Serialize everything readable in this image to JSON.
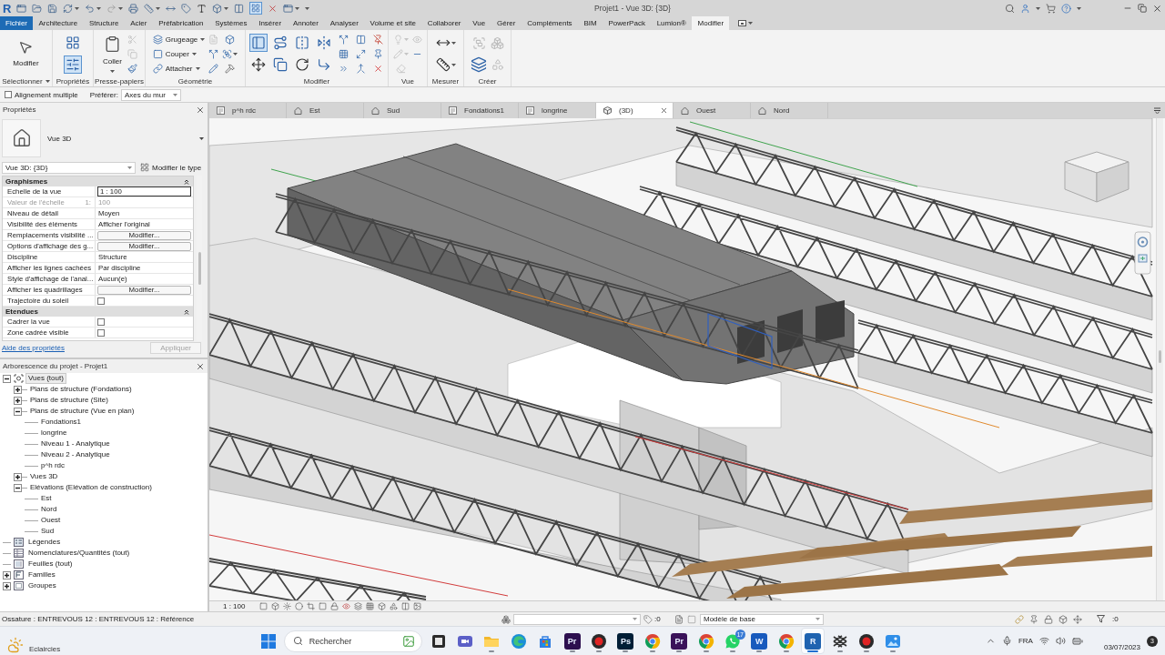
{
  "title_bar": {
    "logo": "R",
    "title": "Projet1 - Vue 3D: {3D}",
    "thin_lines": {
      "on": true
    }
  },
  "ribbon_tabs": [
    {
      "label": "Fichier",
      "kind": "file",
      "selected": false
    },
    {
      "label": "Architecture",
      "kind": "tab",
      "selected": false
    },
    {
      "label": "Structure",
      "kind": "tab",
      "selected": false
    },
    {
      "label": "Acier",
      "kind": "tab",
      "selected": false
    },
    {
      "label": "Préfabrication",
      "kind": "tab",
      "selected": false
    },
    {
      "label": "Systèmes",
      "kind": "tab",
      "selected": false
    },
    {
      "label": "Insérer",
      "kind": "tab",
      "selected": false
    },
    {
      "label": "Annoter",
      "kind": "tab",
      "selected": false
    },
    {
      "label": "Analyser",
      "kind": "tab",
      "selected": false
    },
    {
      "label": "Volume et site",
      "kind": "tab",
      "selected": false
    },
    {
      "label": "Collaborer",
      "kind": "tab",
      "selected": false
    },
    {
      "label": "Vue",
      "kind": "tab",
      "selected": false
    },
    {
      "label": "Gérer",
      "kind": "tab",
      "selected": false
    },
    {
      "label": "Compléments",
      "kind": "tab",
      "selected": false
    },
    {
      "label": "BIM",
      "kind": "tab",
      "selected": false
    },
    {
      "label": "PowerPack",
      "kind": "tab",
      "selected": false
    },
    {
      "label": "Lumion®",
      "kind": "tab",
      "selected": false
    },
    {
      "label": "Modifier",
      "kind": "tab",
      "selected": true
    }
  ],
  "ribbon_panels": [
    {
      "label": "Sélectionner",
      "dropdown": true,
      "tools": [
        {
          "kind": "large",
          "label": "Modifier",
          "disabled": false
        }
      ]
    },
    {
      "label": "Propriétés",
      "dropdown": false,
      "tools": [
        {
          "kind": "icon",
          "disabled": false,
          "on": false
        },
        {
          "kind": "icon",
          "disabled": false,
          "on": true
        }
      ]
    },
    {
      "label": "Presse-papiers",
      "dropdown": false,
      "tools": [
        {
          "kind": "large",
          "label": "Coller",
          "disabled": false
        },
        {
          "kind": "icon",
          "disabled": true
        },
        {
          "kind": "icon",
          "disabled": true
        },
        {
          "kind": "icon",
          "disabled": false
        }
      ]
    },
    {
      "label": "Géométrie",
      "dropdown": false,
      "tools": [
        {
          "kind": "small",
          "label": "Grugeage",
          "disabled": false
        },
        {
          "kind": "small",
          "label": "Couper",
          "disabled": false
        },
        {
          "kind": "small",
          "label": "Attacher",
          "disabled": false
        },
        {
          "kind": "icon",
          "disabled": true
        },
        {
          "kind": "icon",
          "disabled": false
        },
        {
          "kind": "icon",
          "disabled": false
        },
        {
          "kind": "icon",
          "disabled": false
        },
        {
          "kind": "icon",
          "disabled": false
        },
        {
          "kind": "icon",
          "disabled": false
        }
      ]
    },
    {
      "label": "Modifier",
      "dropdown": false,
      "tools": [
        {
          "kind": "icon",
          "disabled": false,
          "on": true
        },
        {
          "kind": "icon",
          "disabled": false,
          "on": false
        },
        {
          "kind": "icon",
          "disabled": false,
          "on": false
        },
        {
          "kind": "icon",
          "disabled": false,
          "on": false
        },
        {
          "kind": "icon",
          "disabled": false,
          "on": false
        },
        {
          "kind": "icon",
          "disabled": false,
          "on": false
        },
        {
          "kind": "icon",
          "disabled": false,
          "on": false
        },
        {
          "kind": "icon",
          "disabled": false,
          "on": false
        },
        {
          "kind": "icon",
          "disabled": false,
          "on": false
        },
        {
          "kind": "icon",
          "disabled": false,
          "on": false
        },
        {
          "kind": "icon",
          "disabled": false,
          "on": false
        },
        {
          "kind": "icon",
          "disabled": false,
          "on": false
        },
        {
          "kind": "icon",
          "disabled": false,
          "on": false
        },
        {
          "kind": "icon",
          "disabled": false,
          "on": false
        },
        {
          "kind": "icon",
          "disabled": false,
          "on": false
        },
        {
          "kind": "icon",
          "disabled": false,
          "on": false
        },
        {
          "kind": "icon",
          "disabled": false,
          "on": false
        }
      ]
    },
    {
      "label": "Vue",
      "dropdown": false,
      "tools": [
        {
          "kind": "icon",
          "disabled": true
        },
        {
          "kind": "icon",
          "disabled": true
        },
        {
          "kind": "icon",
          "disabled": true
        },
        {
          "kind": "icon",
          "disabled": true
        },
        {
          "kind": "icon",
          "disabled": false
        }
      ]
    },
    {
      "label": "Mesurer",
      "dropdown": false,
      "tools": [
        {
          "kind": "icon",
          "disabled": false
        },
        {
          "kind": "icon",
          "disabled": false
        }
      ]
    },
    {
      "label": "Créer",
      "dropdown": false,
      "tools": [
        {
          "kind": "icon",
          "disabled": true
        },
        {
          "kind": "icon",
          "disabled": false
        },
        {
          "kind": "icon",
          "disabled": true
        },
        {
          "kind": "icon",
          "disabled": true
        }
      ]
    }
  ],
  "options_bar": {
    "multiple_alignment": {
      "label": "Alignement multiple",
      "checked": false
    },
    "prefer": {
      "label": "Préférer:",
      "value": "Axes du mur"
    }
  },
  "properties": {
    "title": "Propriétés",
    "type_name": "Vue 3D",
    "instance": "Vue 3D: {3D}",
    "edit_type": "Modifier le type",
    "groups": [
      {
        "label": "Graphismes",
        "expanded": true,
        "rows": [
          {
            "label": "Echelle de la vue",
            "kind": "input",
            "value": "1 : 100",
            "disabled": false
          },
          {
            "label": "Valeur de l'échelle",
            "label_suffix": "1:",
            "kind": "text",
            "value": "100",
            "disabled": true
          },
          {
            "label": "Niveau de détail",
            "kind": "text",
            "value": "Moyen",
            "disabled": false
          },
          {
            "label": "Visibilité des éléments",
            "kind": "text",
            "value": "Afficher l'original",
            "disabled": false
          },
          {
            "label": "Remplacements visibilité ...",
            "kind": "button",
            "value": "Modifier...",
            "disabled": false
          },
          {
            "label": "Options d'affichage des g...",
            "kind": "button",
            "value": "Modifier...",
            "disabled": false
          },
          {
            "label": "Discipline",
            "kind": "text",
            "value": "Structure",
            "disabled": false
          },
          {
            "label": "Afficher les lignes cachées",
            "kind": "text",
            "value": "Par discipline",
            "disabled": false
          },
          {
            "label": "Style d'affichage de l'anal...",
            "kind": "text",
            "value": "Aucun(e)",
            "disabled": false
          },
          {
            "label": "Afficher les quadrillages",
            "kind": "button",
            "value": "Modifier...",
            "disabled": false
          },
          {
            "label": "Trajectoire du soleil",
            "kind": "checkbox",
            "checked": false,
            "disabled": false
          }
        ]
      },
      {
        "label": "Etendues",
        "expanded": true,
        "rows": [
          {
            "label": "Cadrer la vue",
            "kind": "checkbox",
            "checked": false,
            "disabled": false
          },
          {
            "label": "Zone cadrée visible",
            "kind": "checkbox",
            "checked": false,
            "disabled": false
          }
        ]
      }
    ],
    "help_link": "Aide des propriétés",
    "apply": {
      "label": "Appliquer",
      "disabled": true
    }
  },
  "browser": {
    "title": "Arborescence du projet - Projet1",
    "tree": [
      {
        "label": "Vues (tout)",
        "kind": "views",
        "expanded": true,
        "selected": true,
        "children": [
          {
            "label": "Plans de structure (Fondations)",
            "expanded": false,
            "selected": false
          },
          {
            "label": "Plans de structure (Site)",
            "expanded": false,
            "selected": false
          },
          {
            "label": "Plans de structure (Vue en plan)",
            "expanded": true,
            "selected": false,
            "children": [
              {
                "label": "Fondations1",
                "selected": false
              },
              {
                "label": "longrine",
                "selected": false
              },
              {
                "label": "Niveau 1 - Analytique",
                "selected": false
              },
              {
                "label": "Niveau 2 - Analytique",
                "selected": false
              },
              {
                "label": "p^h rdc",
                "selected": false
              }
            ]
          },
          {
            "label": "Vues 3D",
            "expanded": false,
            "selected": false
          },
          {
            "label": "Elévations (Elévation de construction)",
            "expanded": true,
            "selected": false,
            "children": [
              {
                "label": "Est",
                "selected": false
              },
              {
                "label": "Nord",
                "selected": false
              },
              {
                "label": "Ouest",
                "selected": false
              },
              {
                "label": "Sud",
                "selected": false
              }
            ]
          }
        ]
      },
      {
        "label": "Légendes",
        "kind": "legends",
        "selected": false
      },
      {
        "label": "Nomenclatures/Quantités (tout)",
        "kind": "schedules",
        "selected": false
      },
      {
        "label": "Feuilles (tout)",
        "kind": "sheets",
        "selected": false
      },
      {
        "label": "Familles",
        "kind": "families",
        "expanded": false,
        "selected": false
      },
      {
        "label": "Groupes",
        "kind": "groups",
        "expanded": false,
        "selected": false
      }
    ]
  },
  "view_tabs": [
    {
      "label": "p^h rdc",
      "kind": "plan",
      "selected": false
    },
    {
      "label": "Est",
      "kind": "elevation",
      "selected": false
    },
    {
      "label": "Sud",
      "kind": "elevation",
      "selected": false
    },
    {
      "label": "Fondations1",
      "kind": "plan",
      "selected": false
    },
    {
      "label": "longrine",
      "kind": "plan",
      "selected": false
    },
    {
      "label": "(3D)",
      "kind": "perspective",
      "selected": true
    },
    {
      "label": "Ouest",
      "kind": "elevation",
      "selected": false
    },
    {
      "label": "Nord",
      "kind": "elevation",
      "selected": false
    }
  ],
  "view_control_bar": {
    "scale": "1 : 100"
  },
  "status_bar": {
    "message": "Ossature : ENTREVOUS 12 : ENTREVOUS 12 : Référence",
    "counter": ":0",
    "model": "Modèle de base",
    "filter_counter": ":0"
  },
  "taskbar": {
    "weather": "Eclaircies",
    "search": {
      "placeholder": "Rechercher"
    },
    "apps": [
      {
        "kind": "square",
        "running": false,
        "active": false
      },
      {
        "kind": "chat",
        "running": false,
        "active": false
      },
      {
        "kind": "folder",
        "running": true,
        "active": false
      },
      {
        "kind": "edge",
        "running": false,
        "active": false
      },
      {
        "kind": "store",
        "running": false,
        "active": false
      },
      {
        "kind": "tile",
        "label": "Pr",
        "color": "#2d0f4f",
        "running": true,
        "active": false
      },
      {
        "kind": "record",
        "running": true,
        "active": false
      },
      {
        "kind": "tile",
        "label": "Ps",
        "color": "#001e36",
        "running": true,
        "active": false
      },
      {
        "kind": "chrome",
        "running": true,
        "active": false
      },
      {
        "kind": "tile",
        "label": "Pr",
        "color": "#3a1259",
        "running": true,
        "active": false
      },
      {
        "kind": "chrome",
        "running": true,
        "active": false
      },
      {
        "kind": "whatsapp",
        "badge": "17",
        "running": true,
        "active": false
      },
      {
        "kind": "tile",
        "label": "W",
        "color": "#185abd",
        "running": true,
        "active": false
      },
      {
        "kind": "chrome",
        "running": true,
        "active": false
      },
      {
        "kind": "tile",
        "label": "R",
        "color": "#1f63b0",
        "running": true,
        "active": true
      },
      {
        "kind": "lattice",
        "running": true,
        "active": false
      },
      {
        "kind": "record",
        "running": true,
        "active": false
      },
      {
        "kind": "photos",
        "running": true,
        "active": false
      }
    ],
    "language": "FRA",
    "date": "03/07/2023",
    "notifications": "3"
  }
}
